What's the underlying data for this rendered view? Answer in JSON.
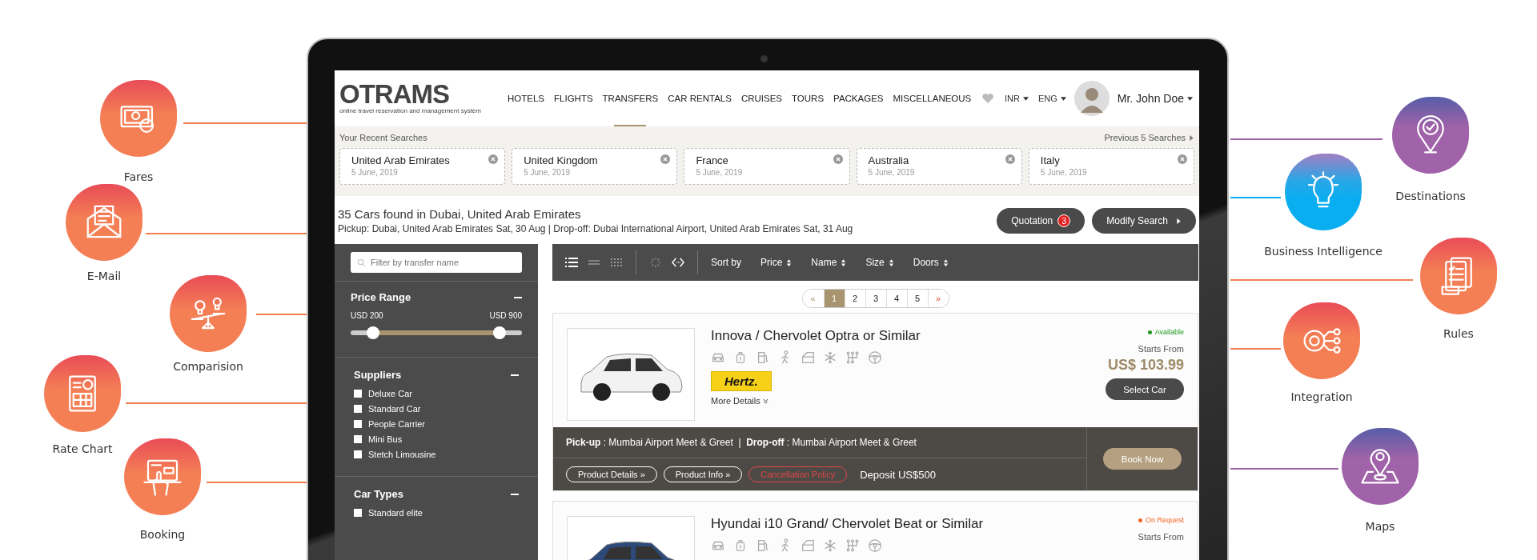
{
  "left_features": [
    {
      "label": "Fares",
      "color": "#f47f55"
    },
    {
      "label": "E-Mail",
      "color": "#f47f55"
    },
    {
      "label": "Comparision",
      "color": "#f47f55"
    },
    {
      "label": "Rate Chart",
      "color": "#f47f55"
    },
    {
      "label": "Booking",
      "color": "#f47f55"
    }
  ],
  "right_features": [
    {
      "label": "Destinations",
      "color": "#a062a8"
    },
    {
      "label": "Business Intelligence",
      "color": "#08aef0"
    },
    {
      "label": "Rules",
      "color": "#f47f55"
    },
    {
      "label": "Integration",
      "color": "#f47f55"
    },
    {
      "label": "Maps",
      "color": "#a062a8"
    }
  ],
  "app": {
    "logo": {
      "wordmark": "OTRAMS",
      "tagline": "online travel reservation and management system"
    },
    "nav": [
      {
        "label": "HOTELS",
        "selected": false
      },
      {
        "label": "FLIGHTS",
        "selected": false
      },
      {
        "label": "TRANSFERS",
        "selected": true
      },
      {
        "label": "CAR RENTALS",
        "selected": false
      },
      {
        "label": "CRUISES",
        "selected": false
      },
      {
        "label": "TOURS",
        "selected": false
      },
      {
        "label": "PACKAGES",
        "selected": false
      },
      {
        "label": "MISCELLANEOUS",
        "selected": false
      }
    ],
    "currency": "INR",
    "language": "ENG",
    "user": "Mr. John Doe",
    "recent_searches": {
      "title": "Your Recent Searches",
      "link": "Previous 5 Searches",
      "items": [
        {
          "place": "United Arab Emirates",
          "date": "5 June, 2019"
        },
        {
          "place": "United Kingdom",
          "date": "5 June, 2019"
        },
        {
          "place": "France",
          "date": "5 June, 2019"
        },
        {
          "place": "Australia",
          "date": "5 June, 2019"
        },
        {
          "place": "Italy",
          "date": "5 June, 2019"
        }
      ]
    },
    "results": {
      "title": "35 Cars found in Dubai, United Arab Emirates",
      "summary": "Pickup: Dubai, United Arab Emirates Sat, 30 Aug | Drop-off: Dubai International Airport, United Arab Emirates Sat, 31 Aug",
      "quotation": "Quotation",
      "quotation_count": "3",
      "modify": "Modify Search"
    },
    "filters": {
      "search_placeholder": "Filter by transfer name",
      "price": {
        "title": "Price Range",
        "min_label": "USD 200",
        "max_label": "USD 900",
        "thumbs": [
          {
            "level": 0.13
          },
          {
            "level": 0.87
          }
        ]
      },
      "groups": [
        {
          "title": "Suppliers",
          "items": [
            {
              "label": "Deluxe Car",
              "checked": false
            },
            {
              "label": "Standard Car",
              "checked": false
            },
            {
              "label": "People Carrier",
              "checked": false
            },
            {
              "label": "Mini Bus",
              "checked": false
            },
            {
              "label": "Stetch Limousine",
              "checked": false
            }
          ]
        },
        {
          "title": "Car Types",
          "items": [
            {
              "label": "Standard elite",
              "checked": false
            }
          ]
        }
      ]
    },
    "toolbar": {
      "views": [
        {
          "selected": true
        },
        {
          "selected": false
        },
        {
          "selected": false
        }
      ],
      "sort_label": "Sort by",
      "sorts": [
        "Price",
        "Name",
        "Size",
        "Doors"
      ]
    },
    "pagination": [
      {
        "label": "«",
        "selected": false
      },
      {
        "label": "1",
        "selected": true
      },
      {
        "label": "2",
        "selected": false
      },
      {
        "label": "3",
        "selected": false
      },
      {
        "label": "4",
        "selected": false
      },
      {
        "label": "5",
        "selected": false
      },
      {
        "label": "»",
        "selected": false
      }
    ],
    "cars": [
      {
        "name": "Innova / Chervolet Optra or Similar",
        "status": "Available",
        "color": "#1d9a1d",
        "starts_from": "Starts From",
        "price": "US$ 103.99",
        "select": "Select Car",
        "supplier": "Hertz.",
        "more": "More Details",
        "route": "**Pick-up** : Mumbai Airport Meet & Greet  |  **Drop-off** : Mumbai Airport Meet & Greet",
        "links": [
          {
            "label": "Product Details »",
            "kind": "info"
          },
          {
            "label": "Product Info »",
            "kind": "info"
          },
          {
            "label": "Cancellation Policy",
            "kind": "policy"
          }
        ],
        "deposit": "Deposit US$500",
        "book": "Book Now"
      },
      {
        "name": "Hyundai i10 Grand/ Chervolet Beat or Similar",
        "status": "On Request",
        "color": "#f26522",
        "starts_from": "Starts From"
      }
    ]
  }
}
